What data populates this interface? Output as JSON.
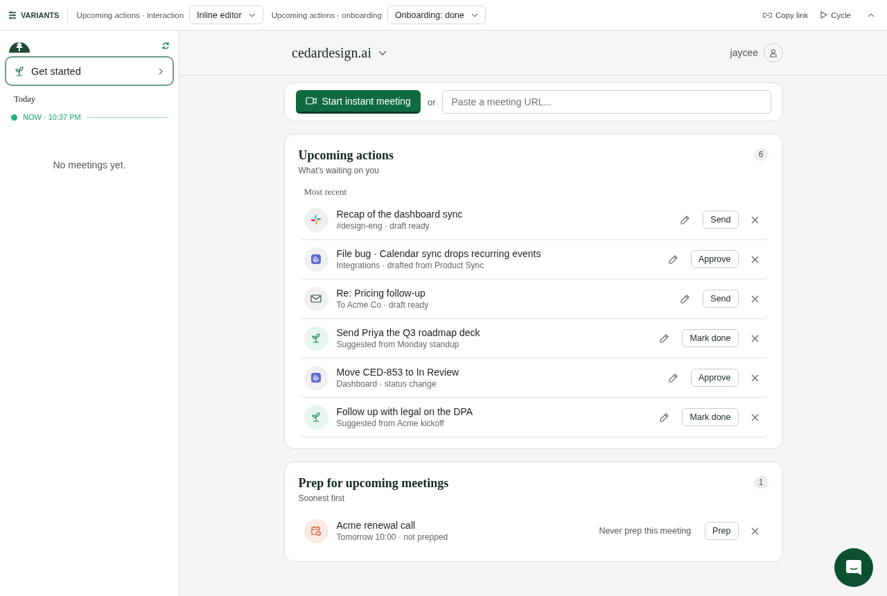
{
  "toolbar": {
    "title": "VARIANTS",
    "controls": [
      {
        "label": "Upcoming actions · interaction",
        "value": "Inline editor"
      },
      {
        "label": "Upcoming actions · onboarding",
        "value": "Onboarding: done"
      }
    ],
    "actions": [
      {
        "kind": "link",
        "label": "Copy link"
      },
      {
        "kind": "play",
        "label": "Cycle"
      }
    ]
  },
  "sidebar": {
    "get_started": "Get started",
    "day": "Today",
    "now": "NOW · 10:37 PM",
    "empty": "No meetings yet."
  },
  "header": {
    "workspace": "cedardesign.ai",
    "user": "jaycee"
  },
  "instant": {
    "button": "Start instant meeting",
    "or": "or",
    "placeholder": "Paste a meeting URL..."
  },
  "upcoming": {
    "title": "Upcoming actions",
    "subtitle": "What's waiting on you",
    "count": "6",
    "group": "Most recent",
    "items": [
      {
        "kind": "slack",
        "title": "Recap of the dashboard sync",
        "meta": "#design-eng · draft ready",
        "action": "Send"
      },
      {
        "kind": "linear",
        "title": "File bug · Calendar sync drops recurring events",
        "meta": "Integrations · drafted from Product Sync",
        "action": "Approve"
      },
      {
        "kind": "mail",
        "title": "Re: Pricing follow-up",
        "meta": "To Acme Co · draft ready",
        "action": "Send"
      },
      {
        "kind": "sprout",
        "title": "Send Priya the Q3 roadmap deck",
        "meta": "Suggested from Monday standup",
        "action": "Mark done"
      },
      {
        "kind": "linear",
        "title": "Move CED-853 to In Review",
        "meta": "Dashboard · status change",
        "action": "Approve"
      },
      {
        "kind": "sprout",
        "title": "Follow up with legal on the DPA",
        "meta": "Suggested from Acme kickoff",
        "action": "Mark done"
      }
    ]
  },
  "prep": {
    "title": "Prep for upcoming meetings",
    "subtitle": "Soonest first",
    "count": "1",
    "items": [
      {
        "kind": "calendar",
        "title": "Acme renewal call",
        "meta": "Tomorrow 10:00 · not prepped",
        "never": "Never prep this meeting",
        "action": "Prep"
      }
    ]
  }
}
